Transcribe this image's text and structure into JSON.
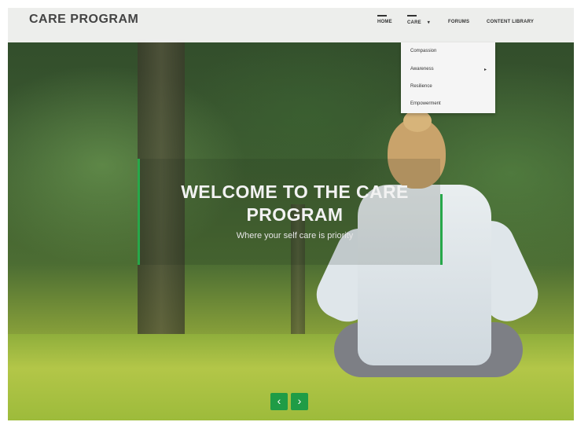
{
  "brand": "CARE PROGRAM",
  "nav": {
    "home": "HOME",
    "care": "CARE",
    "care_caret": "▾",
    "forums": "FORUMS",
    "content_library": "CONTENT LIBRARY"
  },
  "dropdown": {
    "items": [
      "Compassion",
      "Awareness",
      "Resilience",
      "Empowerment"
    ],
    "submenu_arrow": "▸"
  },
  "hero": {
    "title": "WELCOME TO THE CARE PROGRAM",
    "subtitle": "Where your self care is priority"
  },
  "slider": {
    "prev": "‹",
    "next": "›"
  },
  "colors": {
    "accent": "#27a84a",
    "control": "#1f9c46",
    "navbar": "#f5f5f5"
  }
}
